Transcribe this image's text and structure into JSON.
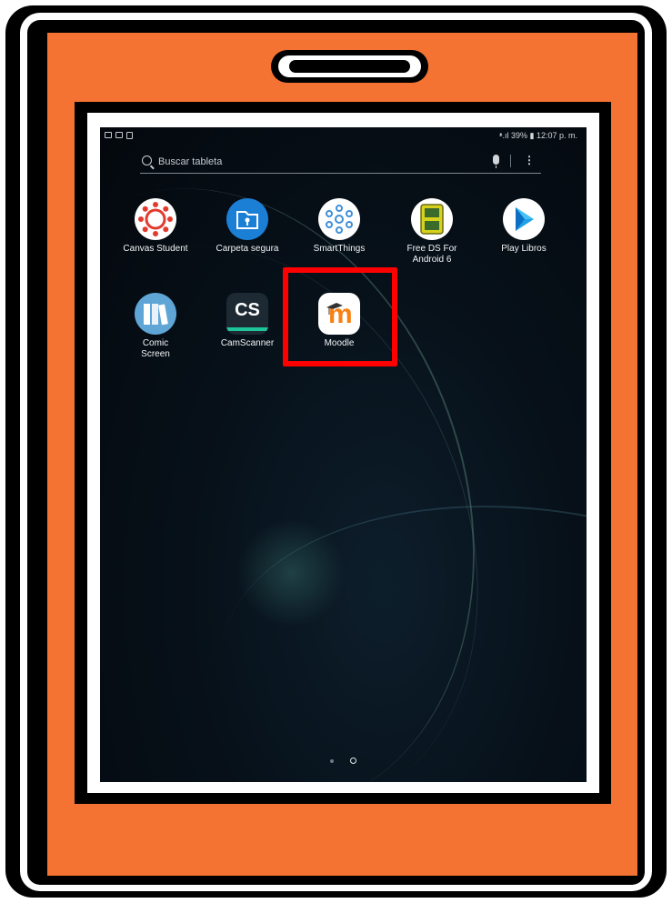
{
  "status_bar": {
    "right_text": "ᵜ.ıl 39% ▮ 12:07 p. m."
  },
  "search": {
    "placeholder": "Buscar tableta"
  },
  "apps_row1": [
    {
      "label": "Canvas Student",
      "icon": "canvas-icon",
      "color": "#e13b2e"
    },
    {
      "label": "Carpeta segura",
      "icon": "secure-folder-icon",
      "color": "#1c7fd6"
    },
    {
      "label": "SmartThings",
      "icon": "smartthings-icon",
      "color": "#3f8fd8"
    },
    {
      "label": "Free DS For Android 6",
      "icon": "ds-emulator-icon",
      "color": "#d6d11c"
    },
    {
      "label": "Play Libros",
      "icon": "play-books-icon",
      "color": "#1fa3e8"
    }
  ],
  "apps_row2": [
    {
      "label": "Comic Screen",
      "icon": "comic-screen-icon",
      "color": "#5fa6d6"
    },
    {
      "label": "CamScanner",
      "icon": "camscanner-icon",
      "color": "#1d2a33",
      "glyph": "CS"
    },
    {
      "label": "Moodle",
      "icon": "moodle-icon",
      "color": "#f98012",
      "glyph": "m"
    }
  ],
  "page_indicator": {
    "pages": 2,
    "current": 2
  },
  "highlight": {
    "color": "#ff0000",
    "target": "Moodle"
  },
  "colors": {
    "frame_orange": "#f47232",
    "screen_bg": "#07111a"
  }
}
